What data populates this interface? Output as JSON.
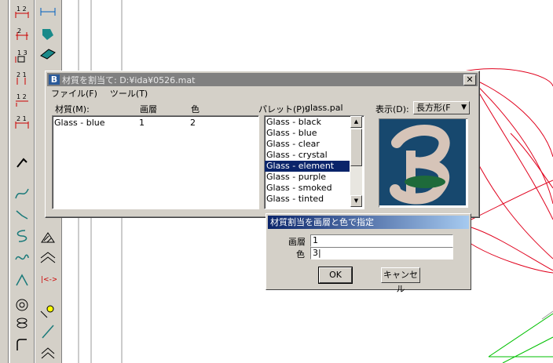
{
  "main_dialog": {
    "title": "材質を割当て: D:¥ida¥0526.mat",
    "close_glyph": "✕",
    "menu": [
      "ファイル(F)",
      "ツール(T)"
    ],
    "columns": {
      "material": "材質(M):",
      "level": "画層",
      "color": "色"
    },
    "materials": [
      {
        "name": "Glass - blue",
        "level": "1",
        "color": "2"
      }
    ],
    "palette_label": "パレット(P):",
    "palette_file": "glass.pal",
    "palette_items": [
      "Glass - black",
      "Glass - blue",
      "Glass - clear",
      "Glass - crystal",
      "Glass - element",
      "Glass - purple",
      "Glass - smoked",
      "Glass - tinted"
    ],
    "palette_selected": "Glass - element",
    "display_label": "表示(D):",
    "display_value": "長方形(F"
  },
  "sub_dialog": {
    "title": "材質割当を画層と色で指定",
    "level_label": "画層",
    "level_value": "1",
    "color_label": "色",
    "color_value": "3|",
    "ok_label": "OK",
    "cancel_label": "キャンセル"
  },
  "colors": {
    "selection": "#0a246a",
    "preview_bg": "#17486e",
    "curve_red": "#e0001c",
    "line_green": "#00c000"
  }
}
